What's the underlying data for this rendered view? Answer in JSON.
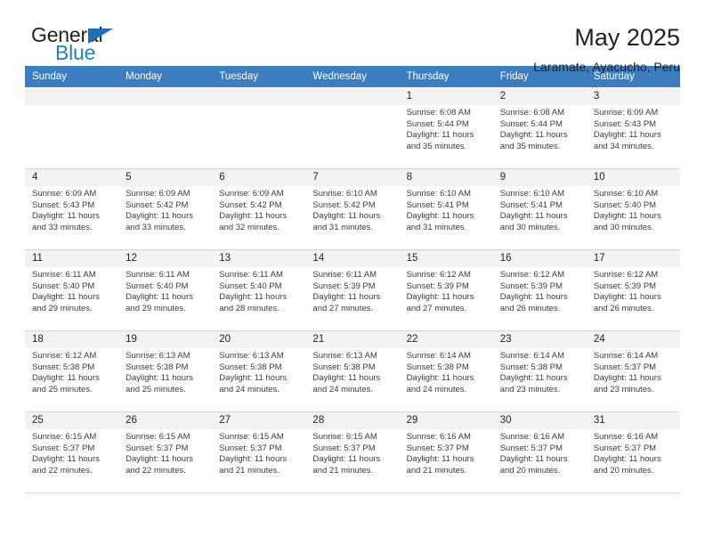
{
  "brand": {
    "name_part1": "General",
    "name_part2": "Blue",
    "triangle_color": "#1f6fb5",
    "blue_color": "#1f7fc4"
  },
  "header": {
    "title": "May 2025",
    "subtitle": "Laramate, Ayacucho, Peru"
  },
  "theme": {
    "header_row_bg": "#3c7dc0",
    "daynum_bg": "#f2f2f2",
    "cell_border": "#d4d4d4",
    "text": "#231f20"
  },
  "weekdays": [
    "Sunday",
    "Monday",
    "Tuesday",
    "Wednesday",
    "Thursday",
    "Friday",
    "Saturday"
  ],
  "weeks": [
    [
      {
        "empty": true
      },
      {
        "empty": true
      },
      {
        "empty": true
      },
      {
        "empty": true
      },
      {
        "day": "1",
        "sunrise": "Sunrise: 6:08 AM",
        "sunset": "Sunset: 5:44 PM",
        "daylight_line1": "Daylight: 11 hours",
        "daylight_line2": "and 35 minutes."
      },
      {
        "day": "2",
        "sunrise": "Sunrise: 6:08 AM",
        "sunset": "Sunset: 5:44 PM",
        "daylight_line1": "Daylight: 11 hours",
        "daylight_line2": "and 35 minutes."
      },
      {
        "day": "3",
        "sunrise": "Sunrise: 6:09 AM",
        "sunset": "Sunset: 5:43 PM",
        "daylight_line1": "Daylight: 11 hours",
        "daylight_line2": "and 34 minutes."
      }
    ],
    [
      {
        "day": "4",
        "sunrise": "Sunrise: 6:09 AM",
        "sunset": "Sunset: 5:43 PM",
        "daylight_line1": "Daylight: 11 hours",
        "daylight_line2": "and 33 minutes."
      },
      {
        "day": "5",
        "sunrise": "Sunrise: 6:09 AM",
        "sunset": "Sunset: 5:42 PM",
        "daylight_line1": "Daylight: 11 hours",
        "daylight_line2": "and 33 minutes."
      },
      {
        "day": "6",
        "sunrise": "Sunrise: 6:09 AM",
        "sunset": "Sunset: 5:42 PM",
        "daylight_line1": "Daylight: 11 hours",
        "daylight_line2": "and 32 minutes."
      },
      {
        "day": "7",
        "sunrise": "Sunrise: 6:10 AM",
        "sunset": "Sunset: 5:42 PM",
        "daylight_line1": "Daylight: 11 hours",
        "daylight_line2": "and 31 minutes."
      },
      {
        "day": "8",
        "sunrise": "Sunrise: 6:10 AM",
        "sunset": "Sunset: 5:41 PM",
        "daylight_line1": "Daylight: 11 hours",
        "daylight_line2": "and 31 minutes."
      },
      {
        "day": "9",
        "sunrise": "Sunrise: 6:10 AM",
        "sunset": "Sunset: 5:41 PM",
        "daylight_line1": "Daylight: 11 hours",
        "daylight_line2": "and 30 minutes."
      },
      {
        "day": "10",
        "sunrise": "Sunrise: 6:10 AM",
        "sunset": "Sunset: 5:40 PM",
        "daylight_line1": "Daylight: 11 hours",
        "daylight_line2": "and 30 minutes."
      }
    ],
    [
      {
        "day": "11",
        "sunrise": "Sunrise: 6:11 AM",
        "sunset": "Sunset: 5:40 PM",
        "daylight_line1": "Daylight: 11 hours",
        "daylight_line2": "and 29 minutes."
      },
      {
        "day": "12",
        "sunrise": "Sunrise: 6:11 AM",
        "sunset": "Sunset: 5:40 PM",
        "daylight_line1": "Daylight: 11 hours",
        "daylight_line2": "and 29 minutes."
      },
      {
        "day": "13",
        "sunrise": "Sunrise: 6:11 AM",
        "sunset": "Sunset: 5:40 PM",
        "daylight_line1": "Daylight: 11 hours",
        "daylight_line2": "and 28 minutes."
      },
      {
        "day": "14",
        "sunrise": "Sunrise: 6:11 AM",
        "sunset": "Sunset: 5:39 PM",
        "daylight_line1": "Daylight: 11 hours",
        "daylight_line2": "and 27 minutes."
      },
      {
        "day": "15",
        "sunrise": "Sunrise: 6:12 AM",
        "sunset": "Sunset: 5:39 PM",
        "daylight_line1": "Daylight: 11 hours",
        "daylight_line2": "and 27 minutes."
      },
      {
        "day": "16",
        "sunrise": "Sunrise: 6:12 AM",
        "sunset": "Sunset: 5:39 PM",
        "daylight_line1": "Daylight: 11 hours",
        "daylight_line2": "and 26 minutes."
      },
      {
        "day": "17",
        "sunrise": "Sunrise: 6:12 AM",
        "sunset": "Sunset: 5:39 PM",
        "daylight_line1": "Daylight: 11 hours",
        "daylight_line2": "and 26 minutes."
      }
    ],
    [
      {
        "day": "18",
        "sunrise": "Sunrise: 6:12 AM",
        "sunset": "Sunset: 5:38 PM",
        "daylight_line1": "Daylight: 11 hours",
        "daylight_line2": "and 25 minutes."
      },
      {
        "day": "19",
        "sunrise": "Sunrise: 6:13 AM",
        "sunset": "Sunset: 5:38 PM",
        "daylight_line1": "Daylight: 11 hours",
        "daylight_line2": "and 25 minutes."
      },
      {
        "day": "20",
        "sunrise": "Sunrise: 6:13 AM",
        "sunset": "Sunset: 5:38 PM",
        "daylight_line1": "Daylight: 11 hours",
        "daylight_line2": "and 24 minutes."
      },
      {
        "day": "21",
        "sunrise": "Sunrise: 6:13 AM",
        "sunset": "Sunset: 5:38 PM",
        "daylight_line1": "Daylight: 11 hours",
        "daylight_line2": "and 24 minutes."
      },
      {
        "day": "22",
        "sunrise": "Sunrise: 6:14 AM",
        "sunset": "Sunset: 5:38 PM",
        "daylight_line1": "Daylight: 11 hours",
        "daylight_line2": "and 24 minutes."
      },
      {
        "day": "23",
        "sunrise": "Sunrise: 6:14 AM",
        "sunset": "Sunset: 5:38 PM",
        "daylight_line1": "Daylight: 11 hours",
        "daylight_line2": "and 23 minutes."
      },
      {
        "day": "24",
        "sunrise": "Sunrise: 6:14 AM",
        "sunset": "Sunset: 5:37 PM",
        "daylight_line1": "Daylight: 11 hours",
        "daylight_line2": "and 23 minutes."
      }
    ],
    [
      {
        "day": "25",
        "sunrise": "Sunrise: 6:15 AM",
        "sunset": "Sunset: 5:37 PM",
        "daylight_line1": "Daylight: 11 hours",
        "daylight_line2": "and 22 minutes."
      },
      {
        "day": "26",
        "sunrise": "Sunrise: 6:15 AM",
        "sunset": "Sunset: 5:37 PM",
        "daylight_line1": "Daylight: 11 hours",
        "daylight_line2": "and 22 minutes."
      },
      {
        "day": "27",
        "sunrise": "Sunrise: 6:15 AM",
        "sunset": "Sunset: 5:37 PM",
        "daylight_line1": "Daylight: 11 hours",
        "daylight_line2": "and 21 minutes."
      },
      {
        "day": "28",
        "sunrise": "Sunrise: 6:15 AM",
        "sunset": "Sunset: 5:37 PM",
        "daylight_line1": "Daylight: 11 hours",
        "daylight_line2": "and 21 minutes."
      },
      {
        "day": "29",
        "sunrise": "Sunrise: 6:16 AM",
        "sunset": "Sunset: 5:37 PM",
        "daylight_line1": "Daylight: 11 hours",
        "daylight_line2": "and 21 minutes."
      },
      {
        "day": "30",
        "sunrise": "Sunrise: 6:16 AM",
        "sunset": "Sunset: 5:37 PM",
        "daylight_line1": "Daylight: 11 hours",
        "daylight_line2": "and 20 minutes."
      },
      {
        "day": "31",
        "sunrise": "Sunrise: 6:16 AM",
        "sunset": "Sunset: 5:37 PM",
        "daylight_line1": "Daylight: 11 hours",
        "daylight_line2": "and 20 minutes."
      }
    ]
  ]
}
